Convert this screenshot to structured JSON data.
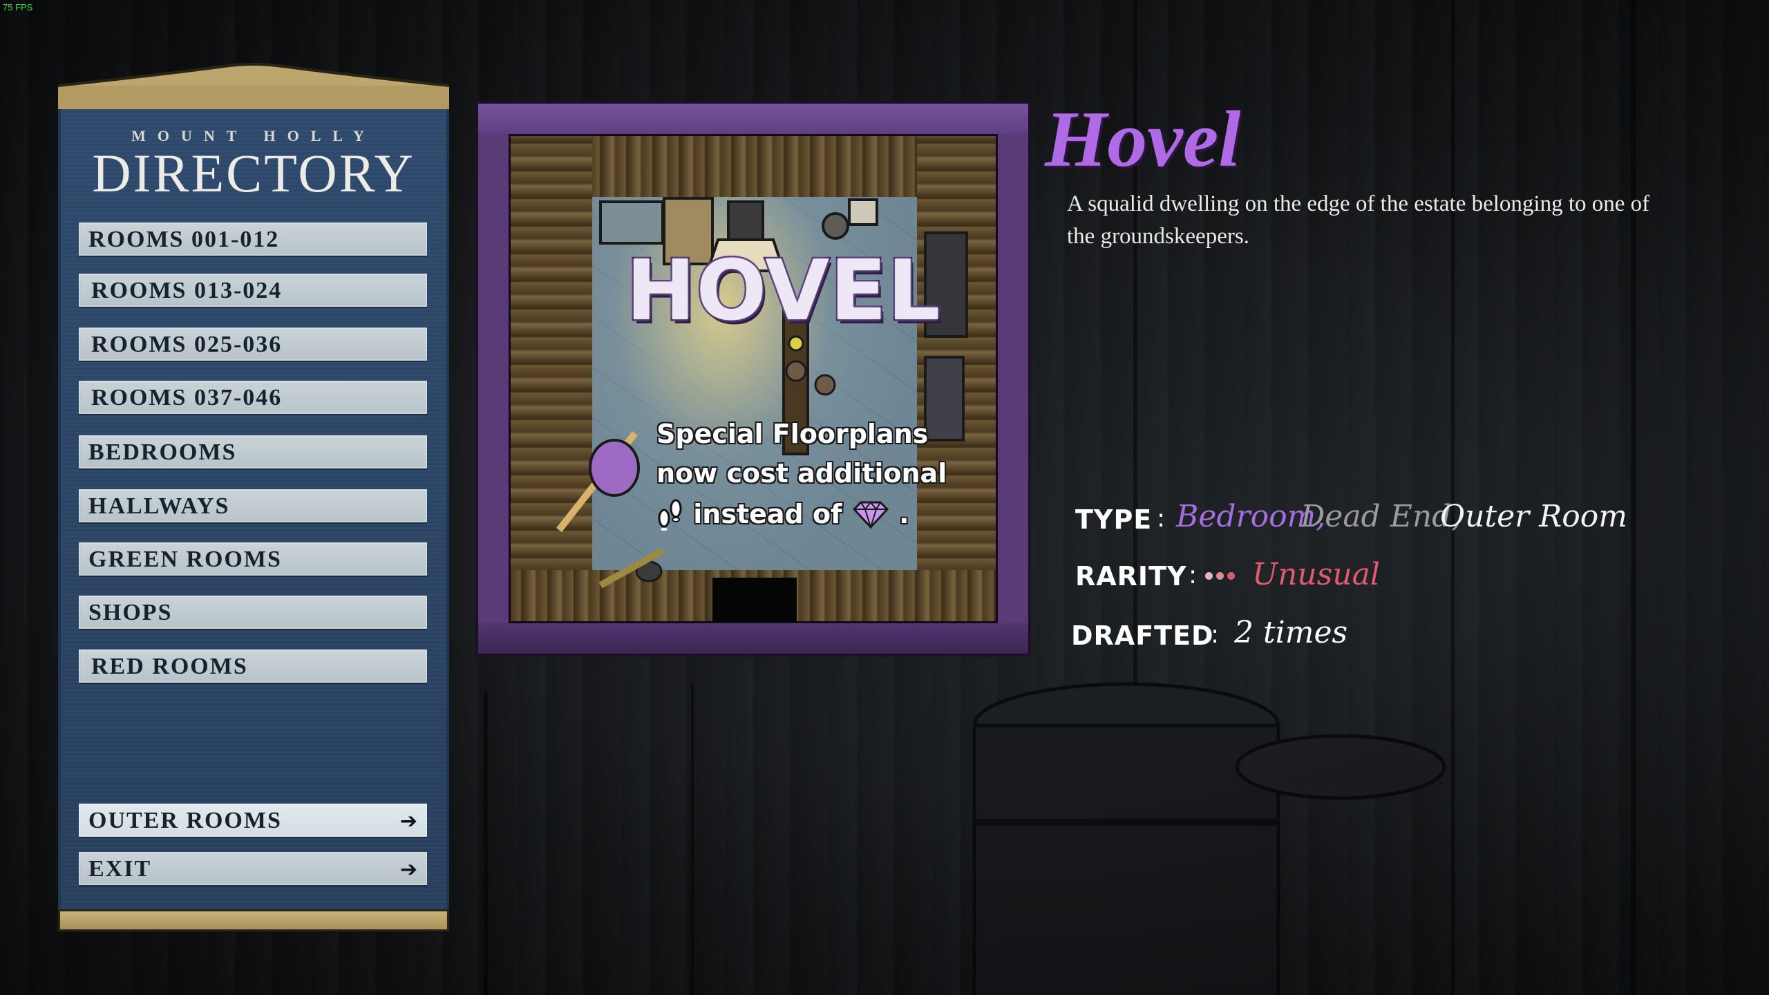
{
  "overlay": {
    "fps": "75 FPS"
  },
  "directory": {
    "subtitle": "MOUNT HOLLY",
    "title": "DIRECTORY",
    "items": [
      {
        "label": "ROOMS 001-012"
      },
      {
        "label": "ROOMS 013-024"
      },
      {
        "label": "ROOMS 025-036"
      },
      {
        "label": "ROOMS 037-046"
      },
      {
        "label": "BEDROOMS"
      },
      {
        "label": "HALLWAYS"
      },
      {
        "label": "GREEN ROOMS"
      },
      {
        "label": "SHOPS"
      },
      {
        "label": "RED ROOMS"
      }
    ],
    "outer_rooms_label": "OUTER ROOMS",
    "exit_label": "EXIT"
  },
  "card": {
    "name": "HOVEL",
    "effect_line1": "Special Floorplans",
    "effect_line2": "now cost additional",
    "effect_line3": "instead of",
    "effect_end": ".",
    "cost_new_icon": "footsteps-icon",
    "cost_old_icon": "gem-icon",
    "frame_color": "#5a3a77"
  },
  "info": {
    "title": "Hovel",
    "description": "A squalid dwelling on the edge of the estate belonging to one of the groundskeepers.",
    "type_label": "TYPE",
    "types": [
      {
        "text": "Bedroom,",
        "color": "#a46ee0"
      },
      {
        "text": "Dead End,",
        "color": "#9a9aa0"
      },
      {
        "text": "Outer Room",
        "color": "#f2f2f2"
      }
    ],
    "rarity_label": "RARITY",
    "rarity": "Unusual",
    "rarity_color": "#e05a6e",
    "drafted_label": "DRAFTED",
    "drafted": "2 times",
    "separator": ":"
  }
}
